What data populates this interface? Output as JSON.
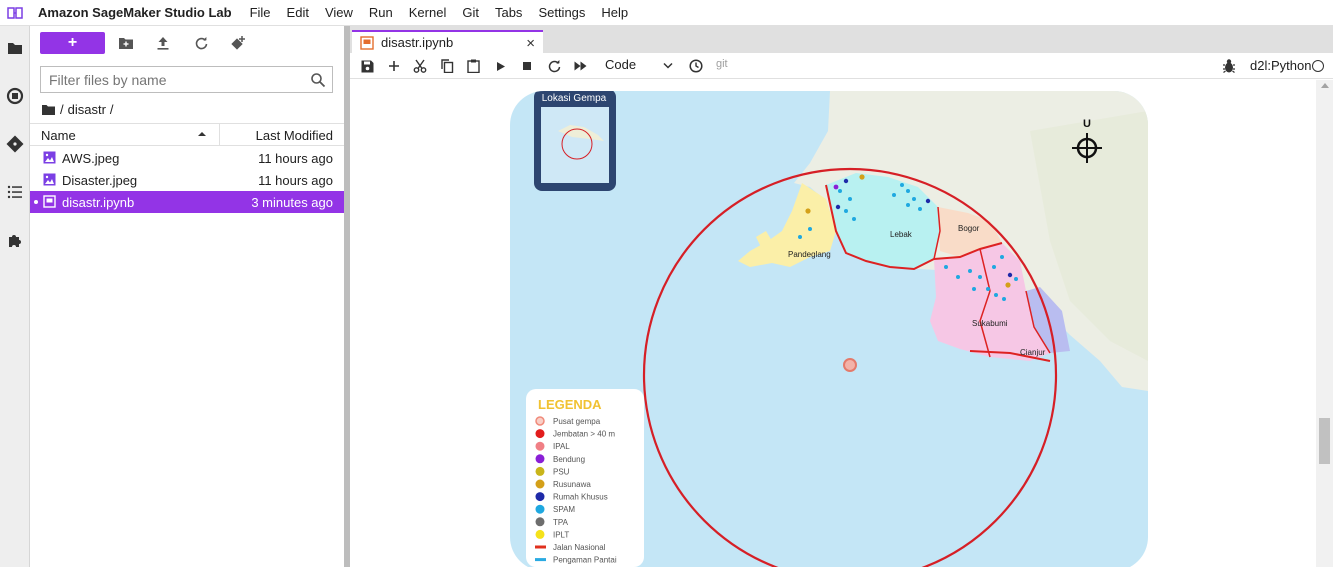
{
  "app": {
    "title": "Amazon SageMaker Studio Lab"
  },
  "menu": [
    "File",
    "Edit",
    "View",
    "Run",
    "Kernel",
    "Git",
    "Tabs",
    "Settings",
    "Help"
  ],
  "filebrowser": {
    "new_label": "+",
    "filter_placeholder": "Filter files by name",
    "breadcrumb_root": "/",
    "breadcrumb_folder": "disastr",
    "breadcrumb_trail": "/",
    "col_name": "Name",
    "col_modified": "Last Modified",
    "files": [
      {
        "name": "AWS.jpeg",
        "modified": "11 hours ago",
        "type": "image"
      },
      {
        "name": "Disaster.jpeg",
        "modified": "11 hours ago",
        "type": "image"
      },
      {
        "name": "disastr.ipynb",
        "modified": "3 minutes ago",
        "type": "notebook",
        "selected": true
      }
    ]
  },
  "tab": {
    "label": "disastr.ipynb",
    "close": "×"
  },
  "toolbar": {
    "cell_type": "Code",
    "git": "git",
    "kernel": "d2l:Python"
  },
  "map": {
    "inset_title": "Lokasi Gempa",
    "north": "U",
    "regions": [
      "Lebak",
      "Bogor",
      "Pandeglang",
      "Sukabumi",
      "Cianjur"
    ],
    "legend_title": "LEGENDA",
    "legend": [
      {
        "label": "Pusat gempa",
        "color": "#f08a7a",
        "kind": "ring"
      },
      {
        "label": "Jembatan > 40 m",
        "color": "#e21d1d",
        "kind": "dot"
      },
      {
        "label": "IPAL",
        "color": "#f07f85",
        "kind": "dot"
      },
      {
        "label": "Bendung",
        "color": "#8a1fd6",
        "kind": "dot"
      },
      {
        "label": "PSU",
        "color": "#c9b51a",
        "kind": "dot"
      },
      {
        "label": "Rusunawa",
        "color": "#d4a019",
        "kind": "dot"
      },
      {
        "label": "Rumah Khusus",
        "color": "#1e2aa8",
        "kind": "dot"
      },
      {
        "label": "SPAM",
        "color": "#1fa8e0",
        "kind": "dot"
      },
      {
        "label": "TPA",
        "color": "#6d6d6d",
        "kind": "dot"
      },
      {
        "label": "IPLT",
        "color": "#f5e21a",
        "kind": "dot"
      },
      {
        "label": "Jalan Nasional",
        "color": "#e0301e",
        "kind": "line"
      },
      {
        "label": "Pengaman Pantai",
        "color": "#2aaae2",
        "kind": "line"
      }
    ]
  },
  "colors": {
    "accent": "#9334e6",
    "sea": "#bfe3f5",
    "circle": "#d61f26"
  }
}
